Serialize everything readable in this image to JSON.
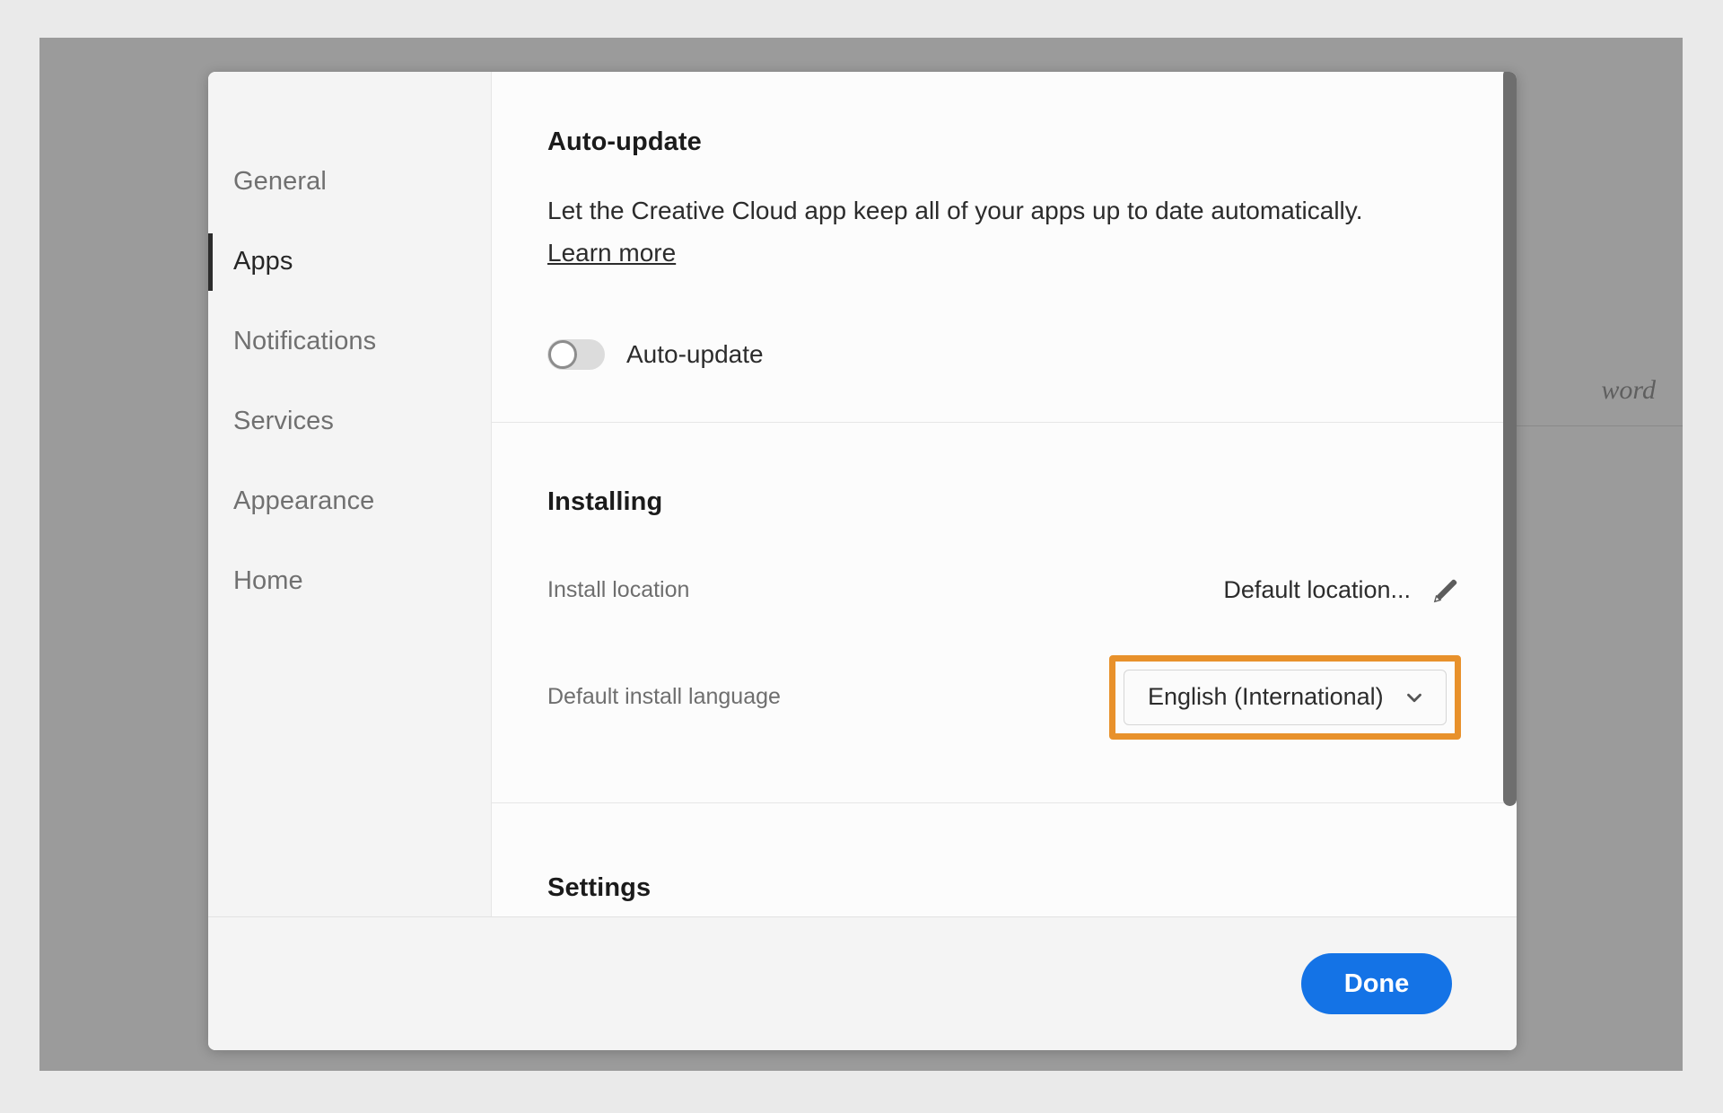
{
  "backdrop": {
    "partial_field_text": "word"
  },
  "dialog": {
    "sidebar": {
      "items": [
        {
          "label": "General",
          "active": false
        },
        {
          "label": "Apps",
          "active": true
        },
        {
          "label": "Notifications",
          "active": false
        },
        {
          "label": "Services",
          "active": false
        },
        {
          "label": "Appearance",
          "active": false
        },
        {
          "label": "Home",
          "active": false
        }
      ]
    },
    "sections": {
      "auto_update": {
        "title": "Auto-update",
        "description": "Let the Creative Cloud app keep all of your apps up to date automatically.",
        "learn_more": "Learn more",
        "toggle_label": "Auto-update",
        "toggle_state": "off"
      },
      "installing": {
        "title": "Installing",
        "install_location_label": "Install location",
        "install_location_value": "Default location...",
        "edit_icon": "pencil-icon",
        "language_label": "Default install language",
        "language_value": "English (International)",
        "dropdown_icon": "chevron-down-icon",
        "highlight_color": "#e8912b"
      },
      "settings": {
        "title": "Settings"
      }
    },
    "footer": {
      "done_label": "Done",
      "done_color": "#1473e6"
    }
  }
}
